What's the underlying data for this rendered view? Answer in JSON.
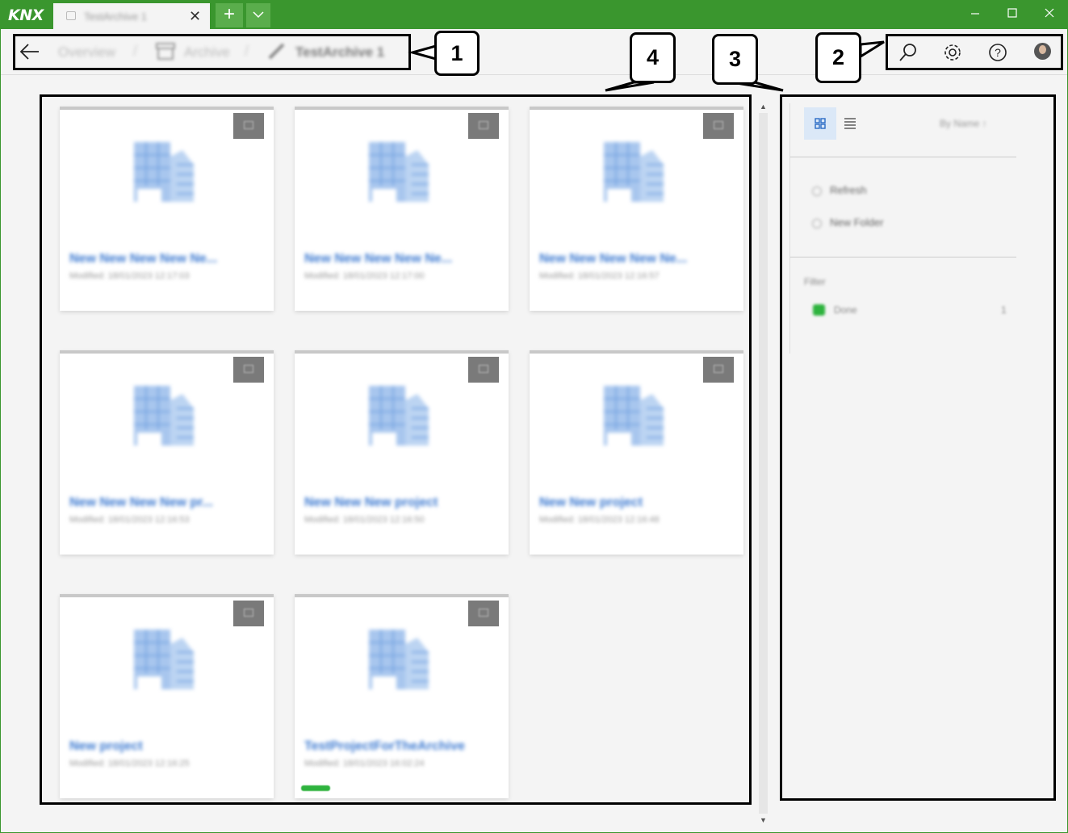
{
  "app": {
    "logo": "KNX",
    "tab_title": "TestArchive 1",
    "new_tab": "+"
  },
  "breadcrumb": {
    "overview": "Overview",
    "archive": "Archive",
    "current": "TestArchive 1",
    "sep": "/"
  },
  "icons": {
    "back": "back-arrow-icon",
    "search": "search-icon",
    "settings": "gear-icon",
    "help": "help-icon",
    "user": "user-avatar"
  },
  "colors": {
    "titlebar": "#3a962e",
    "accent": "#3a78d0",
    "status": "#2eb33e",
    "tag": "#7a7a7a"
  },
  "projects": [
    {
      "name": "New New New New Ne...",
      "meta": "Modified: 18/01/2023 12:17:03",
      "status": false
    },
    {
      "name": "New New New New Ne...",
      "meta": "Modified: 18/01/2023 12:17:00",
      "status": false
    },
    {
      "name": "New New New New Ne...",
      "meta": "Modified: 18/01/2023 12:16:57",
      "status": false
    },
    {
      "name": "New New New New pr...",
      "meta": "Modified: 18/01/2023 12:16:53",
      "status": false
    },
    {
      "name": "New New New project",
      "meta": "Modified: 18/01/2023 12:16:50",
      "status": false
    },
    {
      "name": "New New project",
      "meta": "Modified: 18/01/2023 12:16:48",
      "status": false
    },
    {
      "name": "New project",
      "meta": "Modified: 18/01/2023 12:16:25",
      "status": false
    },
    {
      "name": "TestProjectForTheArchive",
      "meta": "Modified: 18/01/2023 16:02:24",
      "status": true
    }
  ],
  "side": {
    "sort": "By Name ↑",
    "refresh": "Refresh",
    "new_folder": "New Folder",
    "filter_title": "Filter",
    "filter_label": "Done",
    "filter_count": "1"
  },
  "callouts": {
    "c1": "1",
    "c2": "2",
    "c3": "3",
    "c4": "4"
  }
}
